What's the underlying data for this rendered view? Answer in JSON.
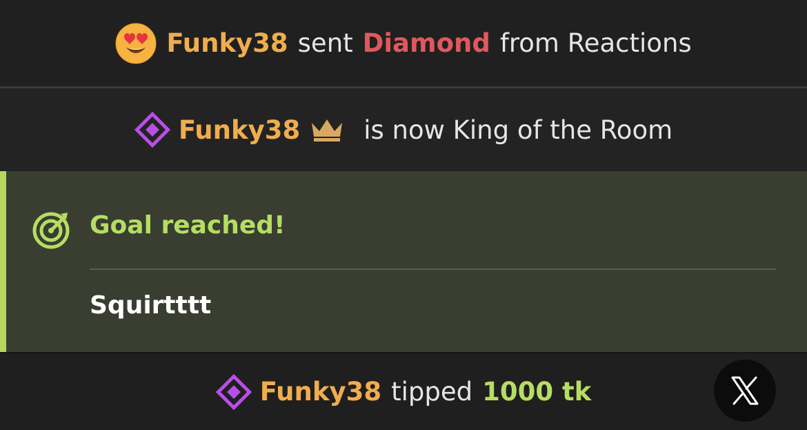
{
  "messages": {
    "reaction": {
      "icon": "heart-eyes-emoji",
      "username": "Funky38",
      "verb": "sent",
      "gift": "Diamond",
      "suffix": "from Reactions"
    },
    "king": {
      "icon": "diamond-badge-icon",
      "username": "Funky38",
      "crown_icon": "crown-icon",
      "text": "is now King of the Room"
    },
    "goal": {
      "icon": "target-icon",
      "title": "Goal reached!",
      "description": "Squirtttt",
      "accent": "#b5d65f"
    },
    "tip": {
      "icon": "diamond-badge-icon",
      "username": "Funky38",
      "verb": "tipped",
      "amount": "1000 tk"
    }
  },
  "colors": {
    "username": "#f0ad4e",
    "gift": "#e0585e",
    "amount": "#b6dd63",
    "badge": "#b84ee8"
  },
  "close_button": {
    "icon": "x-logo-icon"
  }
}
